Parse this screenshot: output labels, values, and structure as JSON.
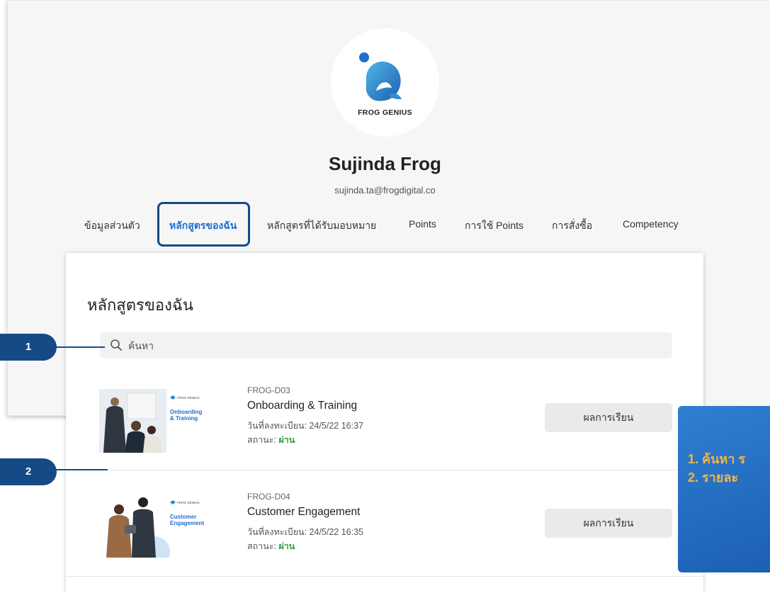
{
  "brand": {
    "logo_text": "FROG GENIUS"
  },
  "profile": {
    "name": "Sujinda Frog",
    "email": "sujinda.ta@frogdigital.co"
  },
  "tabs": [
    {
      "label": "ข้อมูลส่วนตัว"
    },
    {
      "label": "หลักสูตรของฉัน",
      "active": true
    },
    {
      "label": "หลักสูตรที่ได้รับมอบหมาย"
    },
    {
      "label": "Points"
    },
    {
      "label": "การใช้ Points"
    },
    {
      "label": "การสั่งซื้อ"
    },
    {
      "label": "Competency"
    }
  ],
  "panel": {
    "title": "หลักสูตรของฉัน"
  },
  "search": {
    "placeholder": "ค้นหา"
  },
  "courses": [
    {
      "code": "FROG-D03",
      "name": "Onboarding & Training",
      "date": "วันที่ลงทะเบียน: 24/5/22 16:37",
      "status_label": "สถานะ:",
      "status_value": "ผ่าน",
      "button": "ผลการเรียน",
      "thumb_brand": "FROG GENIUS",
      "thumb_line1": "Onboarding",
      "thumb_line2": "& Training"
    },
    {
      "code": "FROG-D04",
      "name": "Customer Engagement",
      "date": "วันที่ลงทะเบียน: 24/5/22 16:35",
      "status_label": "สถานะ:",
      "status_value": "ผ่าน",
      "button": "ผลการเรียน",
      "thumb_brand": "FROG GENIUS",
      "thumb_line1": "Customer",
      "thumb_line2": "Engagement"
    }
  ],
  "callouts": {
    "marker1": "1",
    "marker2": "2",
    "info_line1": "1. ค้นหา ร",
    "info_line2": "2. รายละ"
  },
  "colors": {
    "accent": "#1f6fd0",
    "callout": "#154a86",
    "pass": "#2e9e3a",
    "info_text": "#f7b43c"
  }
}
